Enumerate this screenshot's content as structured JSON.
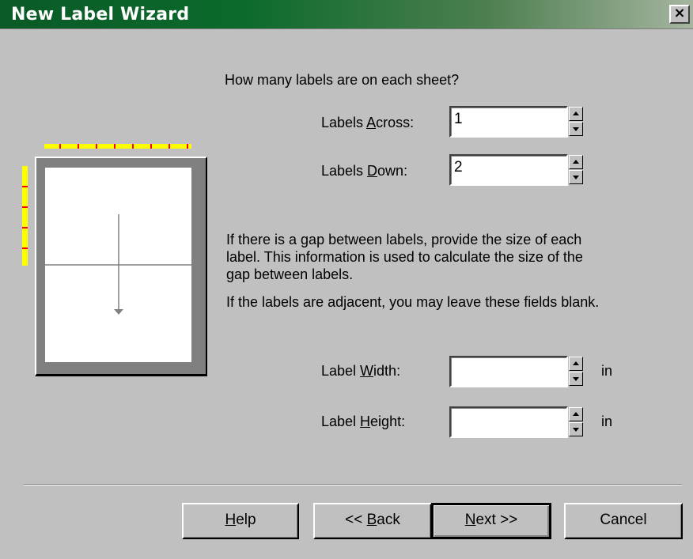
{
  "window": {
    "title": "New Label Wizard",
    "close_glyph": "×"
  },
  "intro": {
    "question": "How many labels are on each sheet?"
  },
  "fields": {
    "labels_across": {
      "label_pre": "Labels ",
      "accel": "A",
      "label_post": "cross:",
      "value": "1"
    },
    "labels_down": {
      "label_pre": "Labels ",
      "accel": "D",
      "label_post": "own:",
      "value": "2"
    },
    "label_width": {
      "label_pre": "Label ",
      "accel": "W",
      "label_post": "idth:",
      "value": "",
      "unit": "in"
    },
    "label_height": {
      "label_pre": "Label ",
      "accel": "H",
      "label_post": "eight:",
      "value": "",
      "unit": "in"
    }
  },
  "info": {
    "gap_line1": "If there is a gap between labels, provide the size of each",
    "gap_line2": "label. This information is used to calculate the size of the",
    "gap_line3": "gap between labels.",
    "adjacent": "If the labels are adjacent, you may leave these fields blank."
  },
  "buttons": {
    "help": {
      "pre": "",
      "accel": "H",
      "post": "elp"
    },
    "back": {
      "pre": "<< ",
      "accel": "B",
      "post": "ack"
    },
    "next": {
      "pre": "",
      "accel": "N",
      "post": "ext >>"
    },
    "cancel": {
      "label": "Cancel"
    }
  },
  "preview": {
    "icons": [
      "page-preview-icon",
      "down-arrow-icon"
    ],
    "labels_across": 1,
    "labels_down": 2
  },
  "colors": {
    "title_bar_start": "#0a5a26",
    "title_bar_end": "#a6b4a0",
    "dialog_bg": "#c0c0c0",
    "ruler": "#ffff00",
    "ruler_ticks": "#ff0000"
  }
}
